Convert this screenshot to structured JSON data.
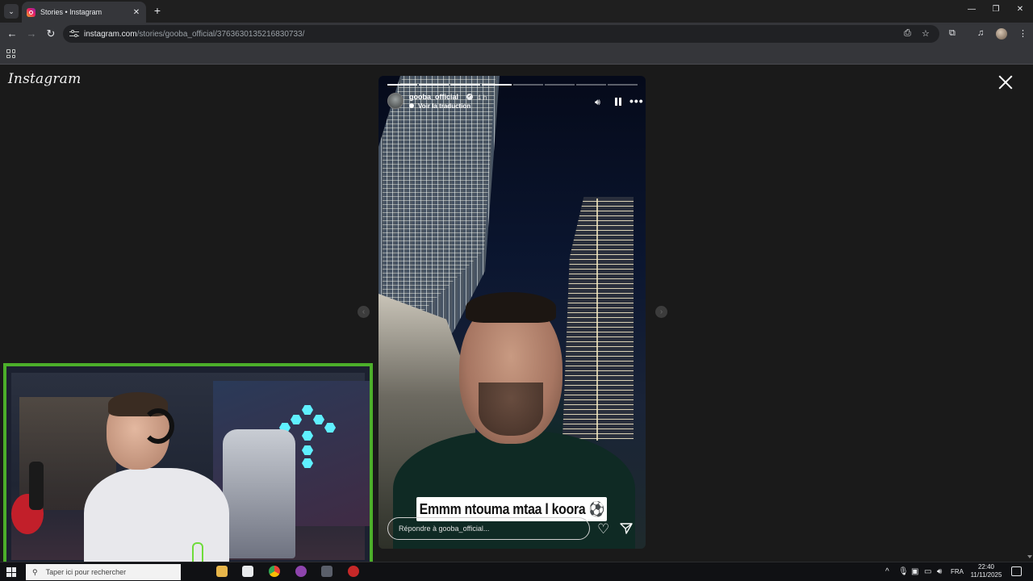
{
  "browser": {
    "tab": {
      "title": "Stories • Instagram"
    },
    "address": {
      "host": "instagram.com",
      "path": "/stories/gooba_official/3763630135216830733/"
    }
  },
  "page": {
    "logo": "Instagram"
  },
  "story": {
    "username": "gooba_official",
    "time": "4 h",
    "translate_label": "Voir la traduction",
    "caption": "Emmm ntouma mtaa l koora ⚽",
    "reply_placeholder": "Répondre à gooba_official...",
    "progress_total": 8,
    "progress_current": 4
  },
  "taskbar": {
    "search_placeholder": "Taper ici pour rechercher",
    "language": "FRA",
    "time": "22:40",
    "date": "11/11/2025"
  },
  "colors": {
    "cam_border": "#4caf2a",
    "page_bg": "#1a1a1a"
  }
}
